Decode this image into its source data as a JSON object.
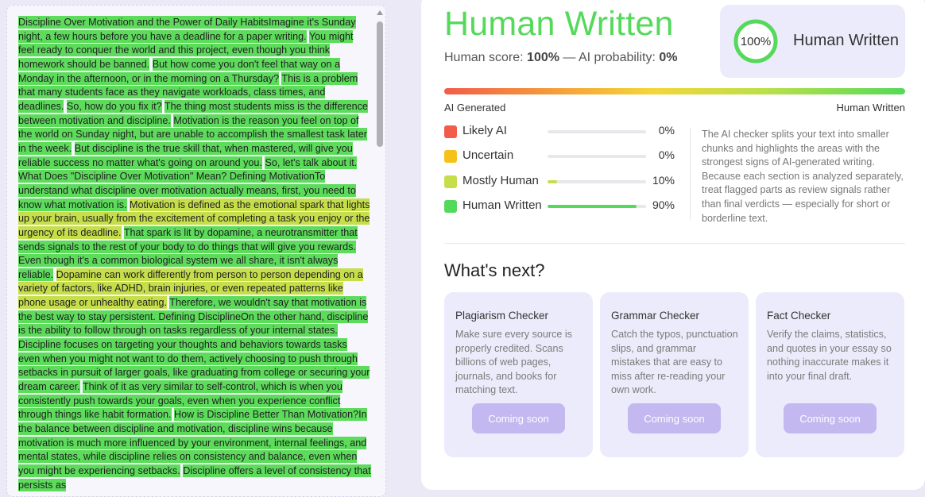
{
  "document": {
    "segments": [
      {
        "text": "Discipline Over Motivation and the Power of Daily HabitsImagine it's Sunday night, a few hours before you have a deadline for a paper writing.",
        "label": "human"
      },
      {
        "text": "You might feel ready to conquer the world and this project, even though you think homework should be banned.",
        "label": "human"
      },
      {
        "text": "But how come you don't feel that way on a Monday in the afternoon, or in the morning on a Thursday?",
        "label": "human"
      },
      {
        "text": "This is a problem that many students face as they navigate workloads, class times, and deadlines.",
        "label": "human"
      },
      {
        "text": "So, how do you fix it?",
        "label": "human"
      },
      {
        "text": "The thing most students miss is the difference between motivation and discipline.",
        "label": "human"
      },
      {
        "text": "Motivation is the reason you feel on top of the world on Sunday night, but are unable to accomplish the smallest task later in the week.",
        "label": "human"
      },
      {
        "text": "But discipline is the true skill that, when mastered, will give you reliable success no matter what's going on around you.",
        "label": "human"
      },
      {
        "text": "So, let's talk about it. What Does \"Discipline Over Motivation\" Mean? Defining MotivationTo understand what discipline over motivation actually means, first, you need to know what motivation is.",
        "label": "human"
      },
      {
        "text": "Motivation is defined as the emotional spark that lights up your brain, usually from the excitement of completing a task you enjoy or the urgency of its deadline.",
        "label": "mostly"
      },
      {
        "text": "That spark is lit by dopamine, a neurotransmitter that sends signals to the rest of your body to do things that will give you rewards.",
        "label": "human"
      },
      {
        "text": "Even though it's a common biological system we all share, it isn't always reliable.",
        "label": "human"
      },
      {
        "text": "Dopamine can work differently from person to person depending on a variety of factors, like ADHD, brain injuries, or even repeated patterns like phone usage or unhealthy eating.",
        "label": "mostly"
      },
      {
        "text": "Therefore, we wouldn't say that motivation is the best way to stay persistent. Defining DisciplineOn the other hand, discipline is the ability to follow through on tasks regardless of your internal states.",
        "label": "human"
      },
      {
        "text": "Discipline focuses on targeting your thoughts and behaviors towards tasks even when you might not want to do them, actively choosing to push through setbacks in pursuit of larger goals, like graduating from college or securing your dream career.",
        "label": "human"
      },
      {
        "text": "Think of it as very similar to self-control, which is when you consistently push towards your goals, even when you experience conflict through things like habit formation.",
        "label": "human"
      },
      {
        "text": "How is Discipline Better Than Motivation?In the balance between discipline and motivation, discipline wins because motivation is much more influenced by your environment, internal feelings, and mental states, while discipline relies on consistency and balance, even when you might be experiencing setbacks.",
        "label": "human"
      },
      {
        "text": "Discipline offers a level of consistency that persists as",
        "label": "human"
      }
    ]
  },
  "result": {
    "verdict": "Human Written",
    "score_prefix": "Human score: ",
    "human_score": "100%",
    "score_separator": " — AI probability: ",
    "ai_probability": "0%",
    "ring_value": 100,
    "ring_label": "100%",
    "badge_label": "Human Written"
  },
  "scale": {
    "left_label": "AI Generated",
    "right_label": "Human Written"
  },
  "categories": [
    {
      "label": "Likely AI",
      "percent_text": "0%",
      "value": 0,
      "color": "#f25c4a"
    },
    {
      "label": "Uncertain",
      "percent_text": "0%",
      "value": 0,
      "color": "#f5c21b"
    },
    {
      "label": "Mostly Human",
      "percent_text": "10%",
      "value": 10,
      "color": "#c6de4a"
    },
    {
      "label": "Human Written",
      "percent_text": "90%",
      "value": 90,
      "color": "#55d95a"
    }
  ],
  "explanation": "The AI checker splits your text into smaller chunks and highlights the areas with the strongest signs of AI-generated writing. Because each section is analyzed separately, treat flagged parts as review signals rather than final verdicts — especially for short or borderline text.",
  "whats_next": {
    "title": "What's next?",
    "cards": [
      {
        "title": "Plagiarism Checker",
        "description": "Make sure every source is properly credited. Scans billions of web pages, journals, and books for matching text.",
        "button": "Coming soon"
      },
      {
        "title": "Grammar Checker",
        "description": "Catch the typos, punctuation slips, and grammar mistakes that are easy to miss after re-reading your own work.",
        "button": "Coming soon"
      },
      {
        "title": "Fact Checker",
        "description": "Verify the claims, statistics, and quotes in your essay so nothing inaccurate makes it into your final draft.",
        "button": "Coming soon"
      }
    ]
  },
  "colors": {
    "human_highlight": "#5ddc5c",
    "mostly_highlight": "#c6de4a",
    "accent_green": "#55d95a",
    "card_bg": "#ecebfb",
    "button_bg": "#c3b8ef"
  }
}
